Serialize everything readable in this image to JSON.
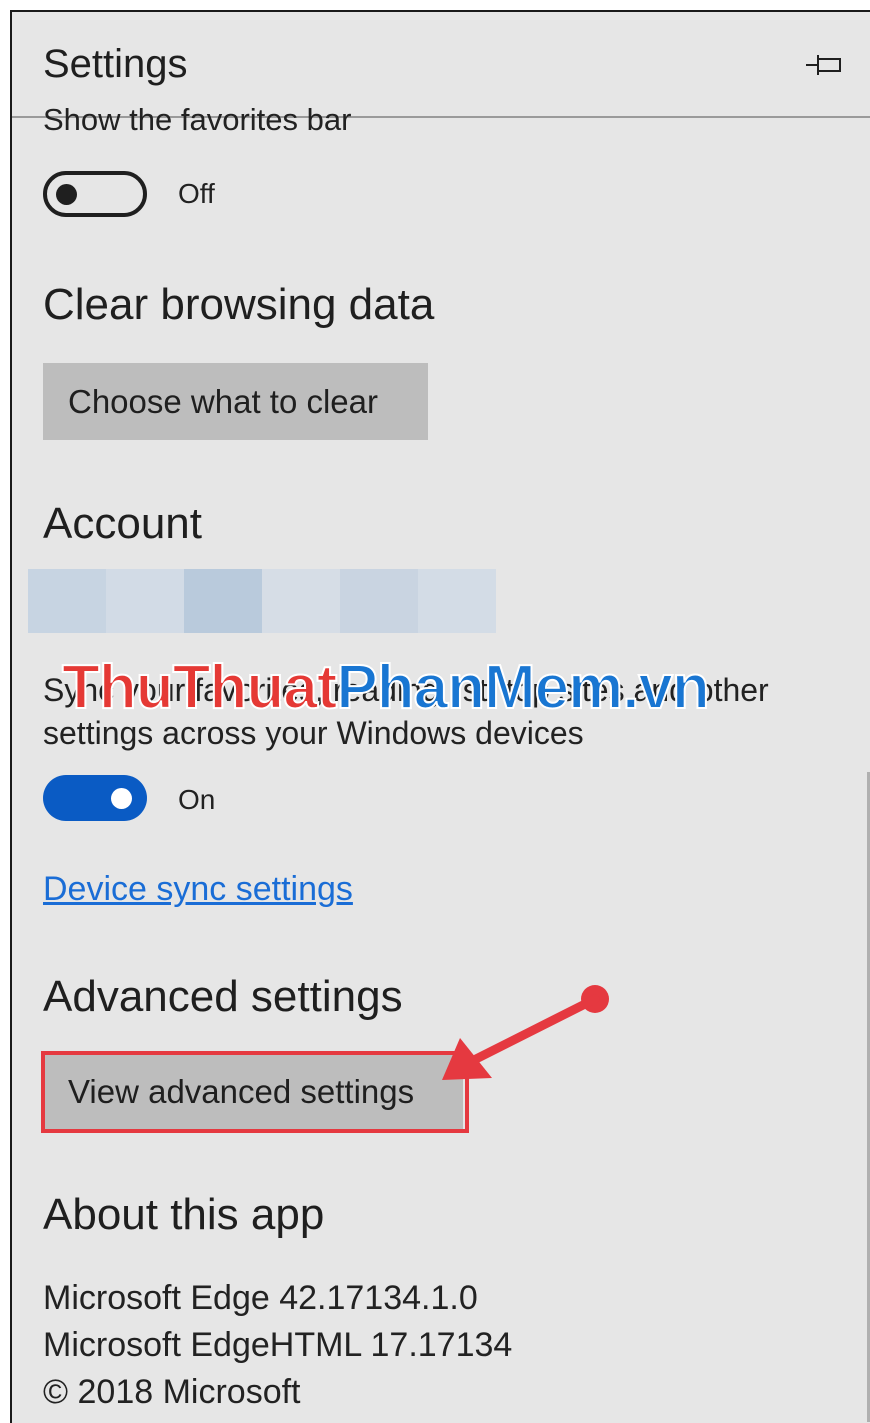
{
  "header": {
    "title": "Settings"
  },
  "favorites_bar": {
    "label": "Show the favorites bar",
    "state": "Off"
  },
  "clear_browsing": {
    "heading": "Clear browsing data",
    "button": "Choose what to clear"
  },
  "account": {
    "heading": "Account",
    "watermark_left": "ThuThuat",
    "watermark_right": "PhanMem.vn",
    "sync_line1": "Sync your favorites, reading list, top sites and other",
    "sync_line2": "settings across your Windows devices",
    "sync_state": "On",
    "link": "Device sync settings"
  },
  "advanced": {
    "heading": "Advanced settings",
    "button": "View advanced settings"
  },
  "about": {
    "heading": "About this app",
    "line1": "Microsoft Edge 42.17134.1.0",
    "line2": "Microsoft EdgeHTML 17.17134",
    "line3": "© 2018 Microsoft"
  },
  "colors": {
    "accent": "#0a5bc4",
    "link": "#1a6dd6",
    "annotation": "#e53940"
  }
}
